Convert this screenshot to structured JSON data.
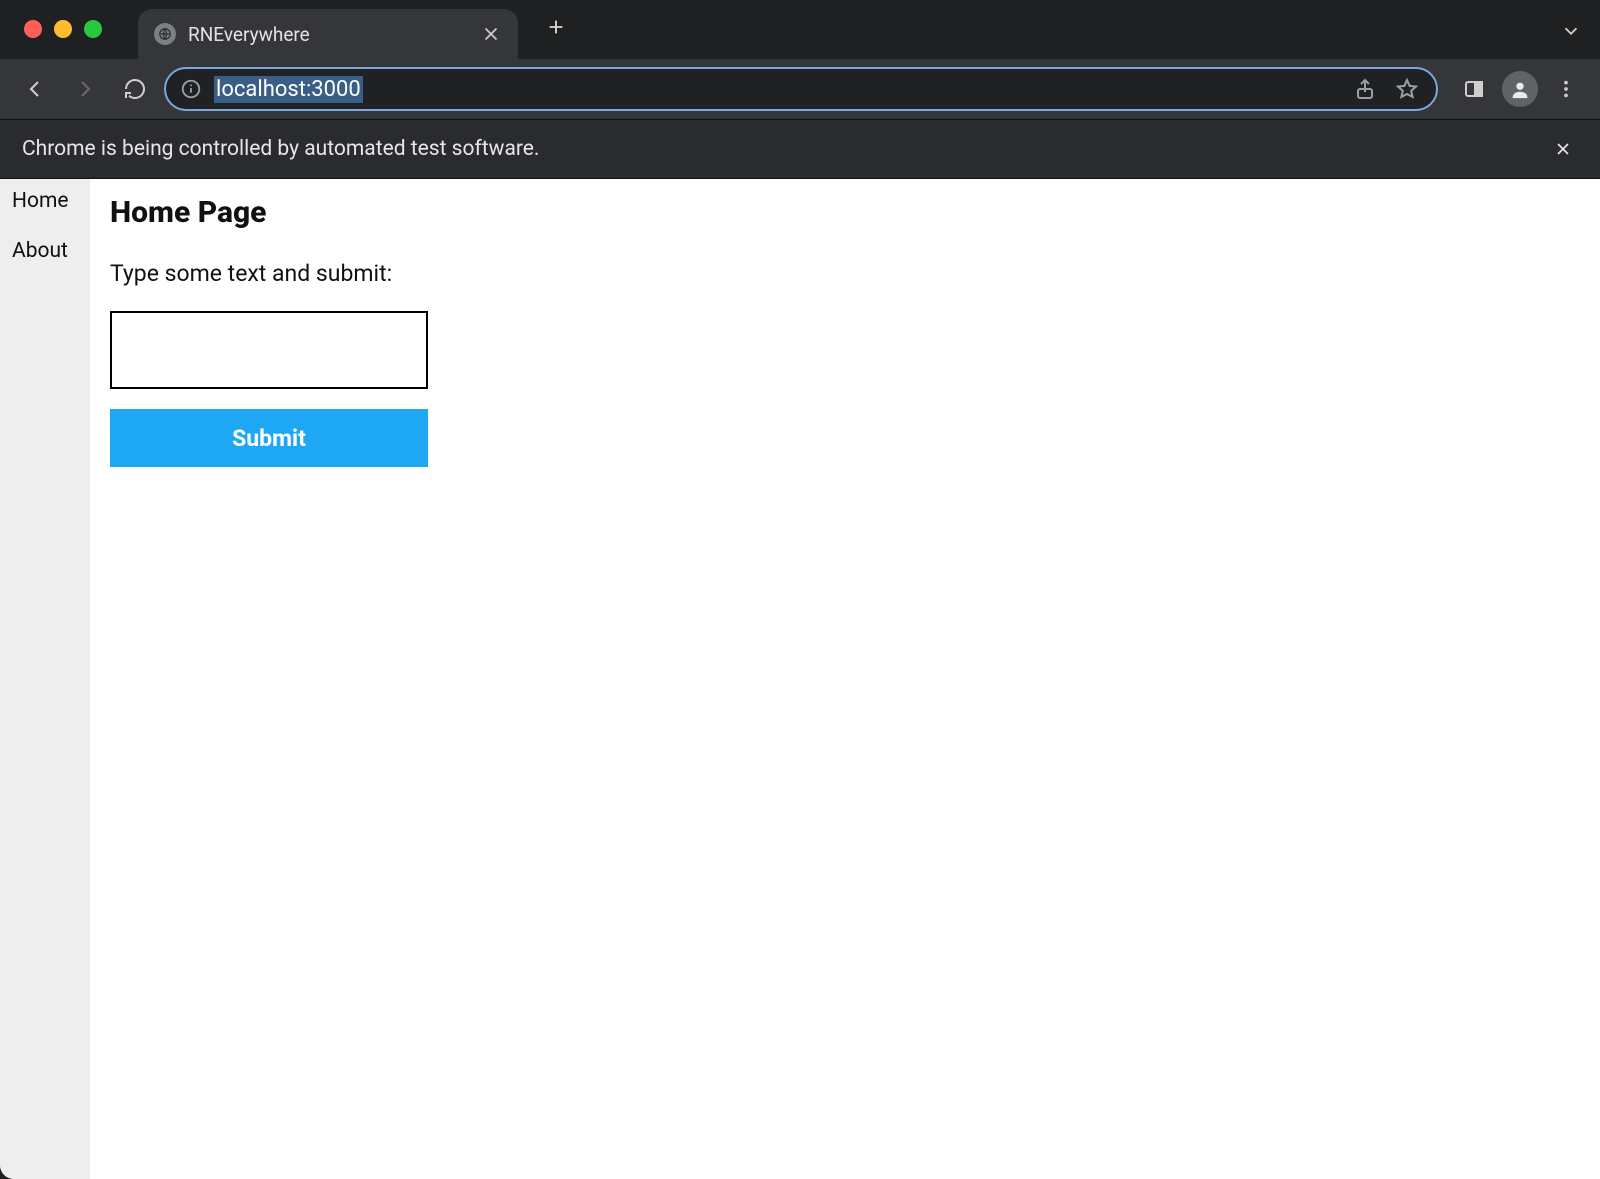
{
  "browser": {
    "tab_title": "RNEverywhere",
    "url": "localhost:3000",
    "infobar_text": "Chrome is being controlled by automated test software."
  },
  "sidebar": {
    "items": [
      {
        "label": "Home"
      },
      {
        "label": "About"
      }
    ]
  },
  "page": {
    "title": "Home Page",
    "prompt": "Type some text and submit:",
    "input_value": "",
    "submit_label": "Submit"
  },
  "colors": {
    "accent": "#1ea7f3"
  }
}
